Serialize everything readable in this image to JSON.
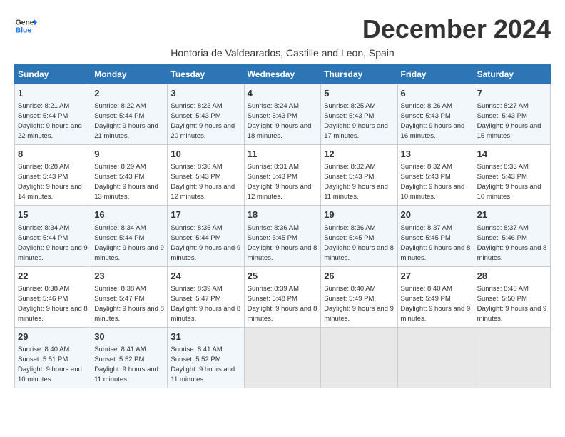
{
  "header": {
    "logo_line1": "General",
    "logo_line2": "Blue",
    "month_title": "December 2024",
    "subtitle": "Hontoria de Valdearados, Castille and Leon, Spain"
  },
  "weekdays": [
    "Sunday",
    "Monday",
    "Tuesday",
    "Wednesday",
    "Thursday",
    "Friday",
    "Saturday"
  ],
  "weeks": [
    [
      {
        "day": "1",
        "sunrise": "8:21 AM",
        "sunset": "5:44 PM",
        "daylight": "9 hours and 22 minutes"
      },
      {
        "day": "2",
        "sunrise": "8:22 AM",
        "sunset": "5:44 PM",
        "daylight": "9 hours and 21 minutes"
      },
      {
        "day": "3",
        "sunrise": "8:23 AM",
        "sunset": "5:43 PM",
        "daylight": "9 hours and 20 minutes"
      },
      {
        "day": "4",
        "sunrise": "8:24 AM",
        "sunset": "5:43 PM",
        "daylight": "9 hours and 18 minutes"
      },
      {
        "day": "5",
        "sunrise": "8:25 AM",
        "sunset": "5:43 PM",
        "daylight": "9 hours and 17 minutes"
      },
      {
        "day": "6",
        "sunrise": "8:26 AM",
        "sunset": "5:43 PM",
        "daylight": "9 hours and 16 minutes"
      },
      {
        "day": "7",
        "sunrise": "8:27 AM",
        "sunset": "5:43 PM",
        "daylight": "9 hours and 15 minutes"
      }
    ],
    [
      {
        "day": "8",
        "sunrise": "8:28 AM",
        "sunset": "5:43 PM",
        "daylight": "9 hours and 14 minutes"
      },
      {
        "day": "9",
        "sunrise": "8:29 AM",
        "sunset": "5:43 PM",
        "daylight": "9 hours and 13 minutes"
      },
      {
        "day": "10",
        "sunrise": "8:30 AM",
        "sunset": "5:43 PM",
        "daylight": "9 hours and 12 minutes"
      },
      {
        "day": "11",
        "sunrise": "8:31 AM",
        "sunset": "5:43 PM",
        "daylight": "9 hours and 12 minutes"
      },
      {
        "day": "12",
        "sunrise": "8:32 AM",
        "sunset": "5:43 PM",
        "daylight": "9 hours and 11 minutes"
      },
      {
        "day": "13",
        "sunrise": "8:32 AM",
        "sunset": "5:43 PM",
        "daylight": "9 hours and 10 minutes"
      },
      {
        "day": "14",
        "sunrise": "8:33 AM",
        "sunset": "5:43 PM",
        "daylight": "9 hours and 10 minutes"
      }
    ],
    [
      {
        "day": "15",
        "sunrise": "8:34 AM",
        "sunset": "5:44 PM",
        "daylight": "9 hours and 9 minutes"
      },
      {
        "day": "16",
        "sunrise": "8:34 AM",
        "sunset": "5:44 PM",
        "daylight": "9 hours and 9 minutes"
      },
      {
        "day": "17",
        "sunrise": "8:35 AM",
        "sunset": "5:44 PM",
        "daylight": "9 hours and 9 minutes"
      },
      {
        "day": "18",
        "sunrise": "8:36 AM",
        "sunset": "5:45 PM",
        "daylight": "9 hours and 8 minutes"
      },
      {
        "day": "19",
        "sunrise": "8:36 AM",
        "sunset": "5:45 PM",
        "daylight": "9 hours and 8 minutes"
      },
      {
        "day": "20",
        "sunrise": "8:37 AM",
        "sunset": "5:45 PM",
        "daylight": "9 hours and 8 minutes"
      },
      {
        "day": "21",
        "sunrise": "8:37 AM",
        "sunset": "5:46 PM",
        "daylight": "9 hours and 8 minutes"
      }
    ],
    [
      {
        "day": "22",
        "sunrise": "8:38 AM",
        "sunset": "5:46 PM",
        "daylight": "9 hours and 8 minutes"
      },
      {
        "day": "23",
        "sunrise": "8:38 AM",
        "sunset": "5:47 PM",
        "daylight": "9 hours and 8 minutes"
      },
      {
        "day": "24",
        "sunrise": "8:39 AM",
        "sunset": "5:47 PM",
        "daylight": "9 hours and 8 minutes"
      },
      {
        "day": "25",
        "sunrise": "8:39 AM",
        "sunset": "5:48 PM",
        "daylight": "9 hours and 8 minutes"
      },
      {
        "day": "26",
        "sunrise": "8:40 AM",
        "sunset": "5:49 PM",
        "daylight": "9 hours and 9 minutes"
      },
      {
        "day": "27",
        "sunrise": "8:40 AM",
        "sunset": "5:49 PM",
        "daylight": "9 hours and 9 minutes"
      },
      {
        "day": "28",
        "sunrise": "8:40 AM",
        "sunset": "5:50 PM",
        "daylight": "9 hours and 9 minutes"
      }
    ],
    [
      {
        "day": "29",
        "sunrise": "8:40 AM",
        "sunset": "5:51 PM",
        "daylight": "9 hours and 10 minutes"
      },
      {
        "day": "30",
        "sunrise": "8:41 AM",
        "sunset": "5:52 PM",
        "daylight": "9 hours and 11 minutes"
      },
      {
        "day": "31",
        "sunrise": "8:41 AM",
        "sunset": "5:52 PM",
        "daylight": "9 hours and 11 minutes"
      },
      null,
      null,
      null,
      null
    ]
  ]
}
